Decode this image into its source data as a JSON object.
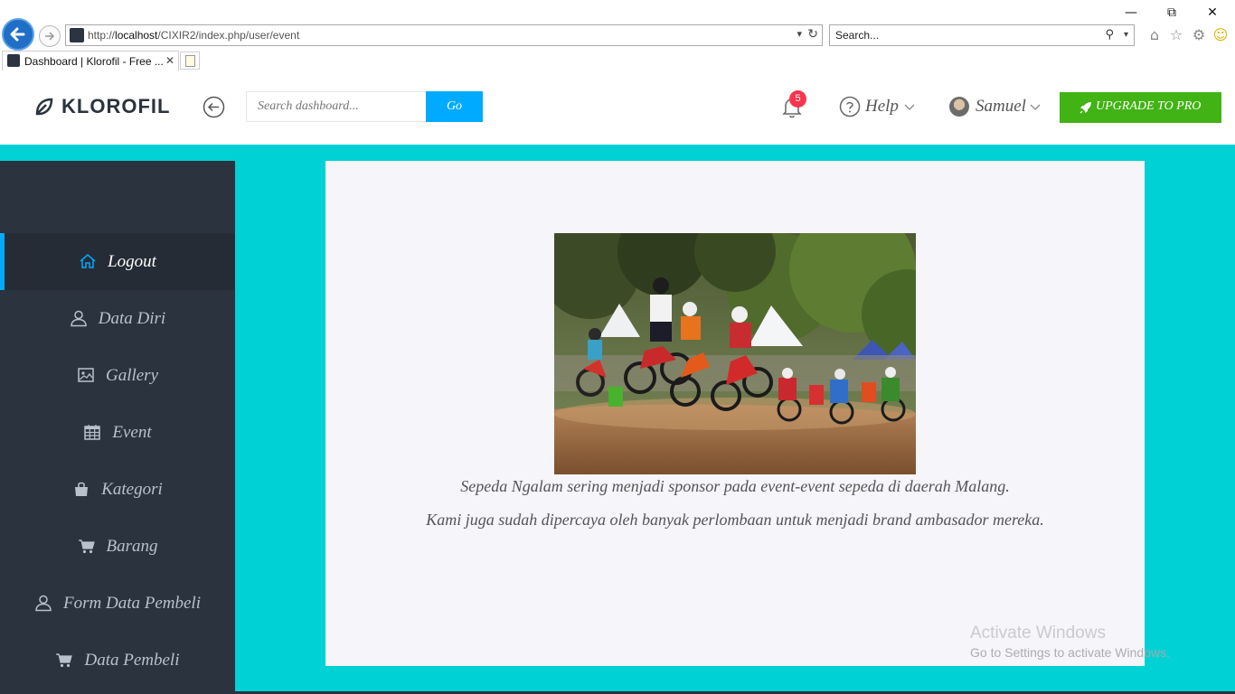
{
  "browser": {
    "url_prefix": "http://",
    "url_host": "localhost",
    "url_path": "/CIXIR2/index.php/user/event",
    "search_placeholder": "Search...",
    "tab_title": "Dashboard | Klorofil - Free ...",
    "window_controls": [
      "minimize",
      "restore",
      "close"
    ],
    "toolbar_icons": [
      "home-icon",
      "favorites-star-icon",
      "settings-gear-icon",
      "smiley-feedback-icon"
    ]
  },
  "header": {
    "logo_text": "KLOROFIL",
    "search_placeholder": "Search dashboard...",
    "go_label": "Go",
    "notification_count": "5",
    "help_label": "Help",
    "user_name": "Samuel",
    "upgrade_label": "UPGRADE TO PRO",
    "colors": {
      "accent": "#00aaff",
      "upgrade": "#41b314",
      "badge": "#f9354c"
    }
  },
  "sidebar": {
    "items": [
      {
        "label": "Logout",
        "icon": "home-icon",
        "active": true
      },
      {
        "label": "Data Diri",
        "icon": "user-icon",
        "active": false
      },
      {
        "label": "Gallery",
        "icon": "image-icon",
        "active": false
      },
      {
        "label": "Event",
        "icon": "calendar-icon",
        "active": false
      },
      {
        "label": "Kategori",
        "icon": "shopping-bag-icon",
        "active": false
      },
      {
        "label": "Barang",
        "icon": "cart-icon",
        "active": false
      },
      {
        "label": "Form Data Pembeli",
        "icon": "user-icon",
        "active": false
      },
      {
        "label": "Data Pembeli",
        "icon": "cart-icon",
        "active": false
      }
    ]
  },
  "main": {
    "caption_1": "Sepeda Ngalam sering menjadi sponsor pada event-event sepeda di daerah Malang.",
    "caption_2": "Kami juga sudah dipercaya oleh banyak perlombaan untuk menjadi brand ambasador mereka."
  },
  "watermark": {
    "title": "Activate Windows",
    "subtitle": "Go to Settings to activate Windows."
  }
}
